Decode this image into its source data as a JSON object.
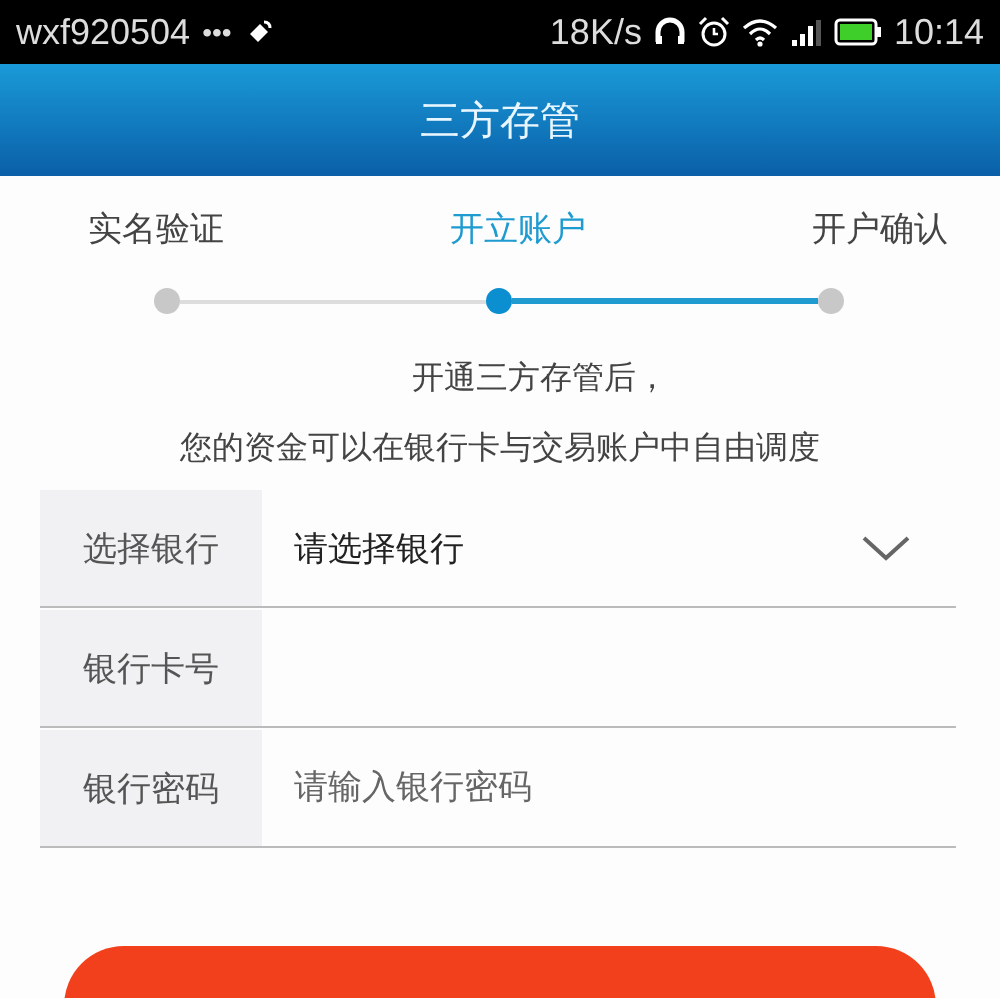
{
  "status_bar": {
    "carrier": "wxf920504",
    "dots": "•••",
    "speed": "18K/s",
    "time": "10:14"
  },
  "window": {
    "title": "三方存管"
  },
  "steps": [
    {
      "label": "实名验证",
      "selected": false
    },
    {
      "label": "开立账户",
      "selected": true
    },
    {
      "label": "开户确认",
      "selected": false
    }
  ],
  "intro": [
    "开通三方存管后，",
    "您的资金可以在银行卡与交易账户中自由调度"
  ],
  "form": [
    {
      "kind": "select",
      "label": "选择银行",
      "value": "请选择银行"
    },
    {
      "kind": "input",
      "label": "银行卡号"
    },
    {
      "kind": "input",
      "label": "银行密码",
      "placeholder": "请输入银行密码"
    }
  ]
}
